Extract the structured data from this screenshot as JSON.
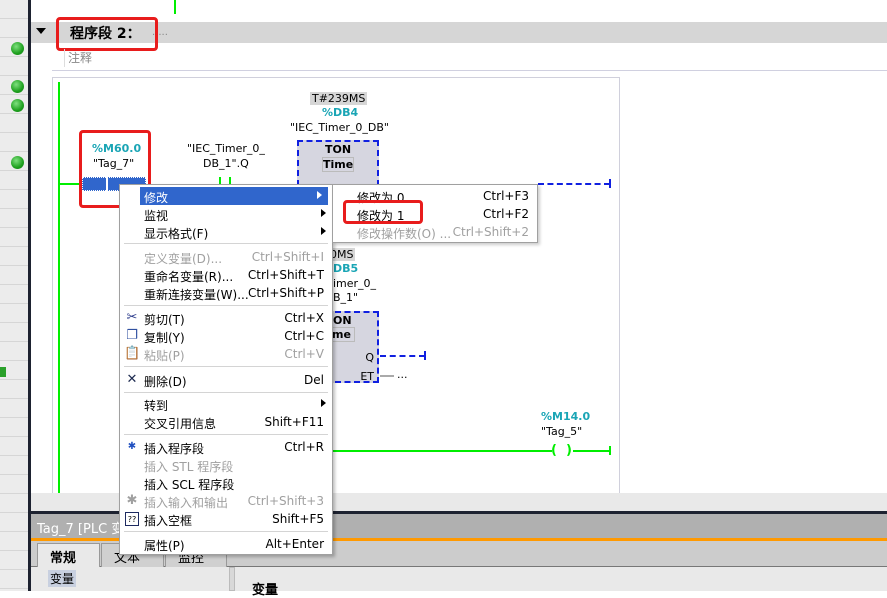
{
  "network": {
    "title": "程序段 2：",
    "title_suffix": ".....",
    "comment": "注释"
  },
  "ladder": {
    "contact1": {
      "address": "%M60.0",
      "tag": "\"Tag_7\""
    },
    "contact2": {
      "line1": "\"IEC_Timer_0_",
      "line2": "DB_1\".Q"
    },
    "timer1": {
      "value": "T#239MS",
      "db": "%DB4",
      "instance": "\"IEC_Timer_0_DB\"",
      "type": "TON",
      "subtype": "Time"
    },
    "timer2": {
      "value": "0MS",
      "db": "DB5",
      "instance_l1": "imer_0_",
      "instance_l2": "B_1\"",
      "type": "ON",
      "subtype": "me",
      "pin_q": "Q",
      "pin_et": "ET",
      "et_value": "..."
    },
    "coil": {
      "address": "%M14.0",
      "tag": "\"Tag_5\""
    }
  },
  "context_menu": {
    "items": [
      {
        "label": "修改",
        "shortcut": "",
        "submenu": true,
        "highlighted": true
      },
      {
        "label": "监视",
        "shortcut": "",
        "submenu": true
      },
      {
        "label": "显示格式(F)",
        "shortcut": "",
        "submenu": true
      },
      {
        "label": "定义变量(D)...",
        "shortcut": "Ctrl+Shift+I",
        "disabled": true
      },
      {
        "label": "重命名变量(R)...",
        "shortcut": "Ctrl+Shift+T"
      },
      {
        "label": "重新连接变量(W)...",
        "shortcut": "Ctrl+Shift+P"
      },
      {
        "label": "剪切(T)",
        "shortcut": "Ctrl+X",
        "icon": "scissors-icon"
      },
      {
        "label": "复制(Y)",
        "shortcut": "Ctrl+C",
        "icon": "copy-icon"
      },
      {
        "label": "粘贴(P)",
        "shortcut": "Ctrl+V",
        "disabled": true,
        "icon": "paste-icon"
      },
      {
        "label": "删除(D)",
        "shortcut": "Del",
        "icon": "delete-x-icon"
      },
      {
        "label": "转到",
        "shortcut": "",
        "submenu": true
      },
      {
        "label": "交叉引用信息",
        "shortcut": "Shift+F11"
      },
      {
        "label": "插入程序段",
        "shortcut": "Ctrl+R",
        "icon": "insert-network-icon"
      },
      {
        "label": "插入 STL 程序段",
        "shortcut": "",
        "disabled": true
      },
      {
        "label": "插入 SCL 程序段",
        "shortcut": ""
      },
      {
        "label": "插入输入和输出",
        "shortcut": "Ctrl+Shift+3",
        "disabled": true,
        "icon": "insert-io-icon"
      },
      {
        "label": "插入空框",
        "shortcut": "Shift+F5",
        "icon": "empty-box-icon"
      },
      {
        "label": "属性(P)",
        "shortcut": "Alt+Enter"
      }
    ]
  },
  "submenu": {
    "items": [
      {
        "label": "修改为 0",
        "shortcut": "Ctrl+F3"
      },
      {
        "label": "修改为 1",
        "shortcut": "Ctrl+F2"
      },
      {
        "label": "修改操作数(O) ...",
        "shortcut": "Ctrl+Shift+2",
        "disabled": true
      }
    ]
  },
  "inspector": {
    "title": "Tag_7 [PLC 变",
    "tabs": [
      "常规",
      "文本",
      "监控"
    ],
    "nav_item": "变量",
    "section_title": "变量"
  },
  "colors": {
    "highlight": "#3066cc",
    "power_flow": "#00ee00",
    "annotation_red": "#e81c1c",
    "accent_orange": "#ff9900",
    "address_teal": "#1aa5b5"
  }
}
